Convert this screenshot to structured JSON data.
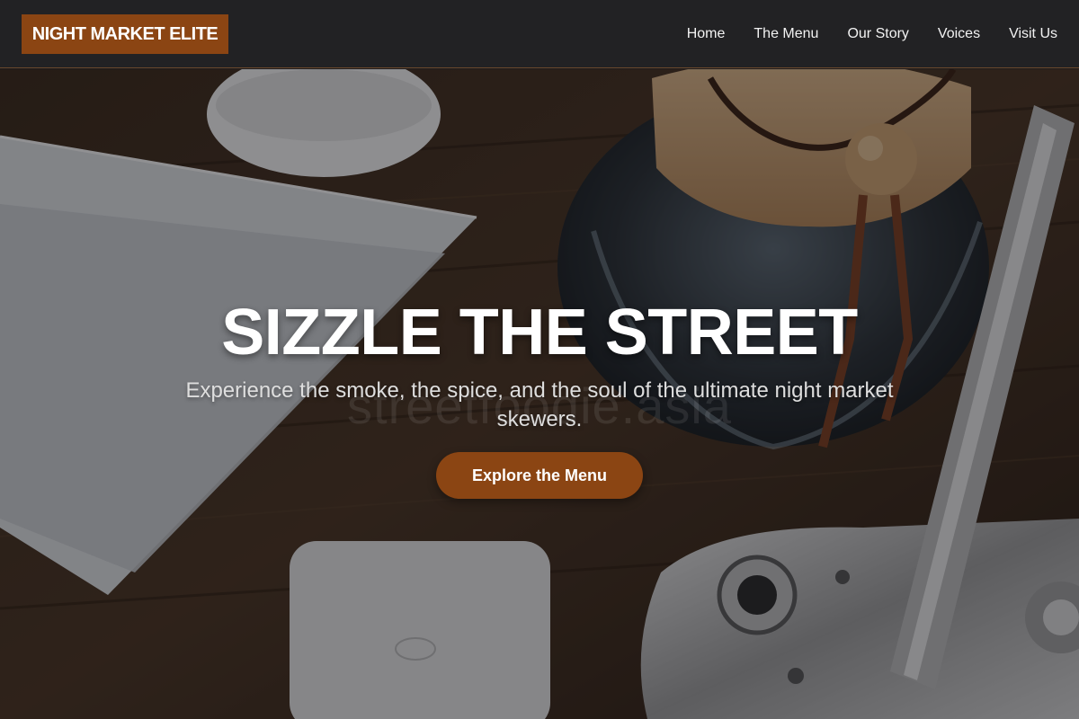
{
  "brand": {
    "name": "NIGHT MARKET ELITE",
    "accent": "#8B4513"
  },
  "nav": {
    "items": [
      {
        "label": "Home"
      },
      {
        "label": "The Menu"
      },
      {
        "label": "Our Story"
      },
      {
        "label": "Voices"
      },
      {
        "label": "Visit Us"
      }
    ]
  },
  "hero": {
    "title": "SIZZLE THE STREET",
    "subtitle": "Experience the smoke, the spice, and the soul of the ultimate night market skewers.",
    "cta_label": "Explore the Menu",
    "watermark": "streetfoodie.asia"
  }
}
